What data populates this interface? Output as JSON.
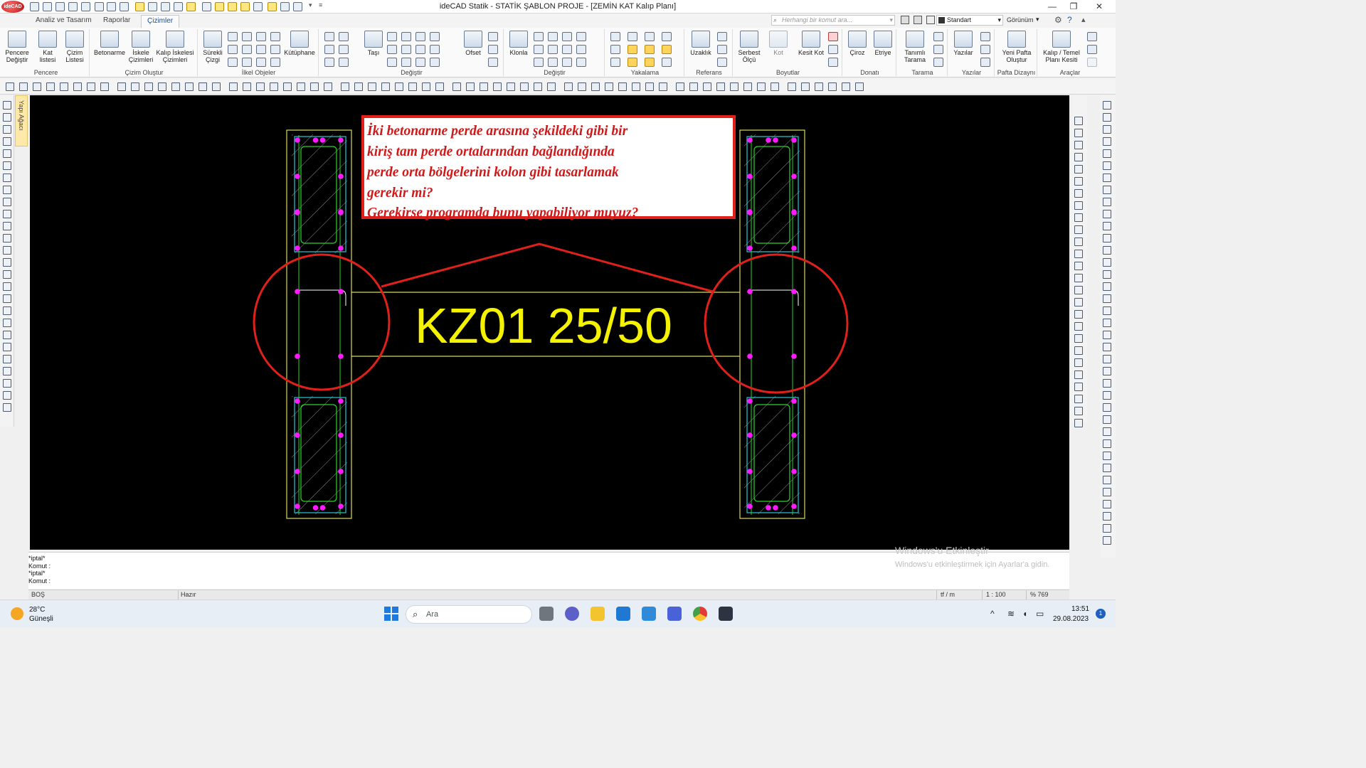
{
  "app": {
    "title": "ideCAD Statik - STATİK ŞABLON PROJE - [ZEMİN KAT Kalıp Planı]",
    "logo_text": "ideCAD"
  },
  "tabs": [
    {
      "label": "Analiz ve Tasarım",
      "active": false
    },
    {
      "label": "Raporlar",
      "active": false
    },
    {
      "label": "Çizimler",
      "active": true
    }
  ],
  "command_search": {
    "placeholder": "Herhangi bir komut ara..."
  },
  "style_select": {
    "value": "Standart"
  },
  "view_label": "Görünüm",
  "ribbon": {
    "groups": {
      "pencere": "Pencere",
      "cizim_olustur": "Çizim Oluştur",
      "ilkel_objeler": "İlkel Objeler",
      "degistir1": "Değiştir",
      "degistir2": "Değiştir",
      "yakalama": "Yakalama",
      "referans": "Referans",
      "boyutlar": "Boyutlar",
      "donati": "Donatı",
      "tarama": "Tarama",
      "yazilar": "Yazılar",
      "pafta": "Pafta Dizaynı",
      "araclar": "Araçlar"
    },
    "buttons": {
      "pencere_degistir": "Pencere Değiştir",
      "kat_listesi": "Kat listesi",
      "cizim_listesi": "Çizim Listesi",
      "betonarme": "Betonarme",
      "iskele_cizimleri": "İskele Çizimleri",
      "kalip_iskelesi": "Kalıp İskelesi Çizimleri",
      "surekli_cizgi": "Sürekli Çizgi",
      "kutuphane": "Kütüphane",
      "tasi": "Taşı",
      "ofset": "Ofset",
      "klonla": "Klonla",
      "uzaklik": "Uzaklık",
      "serbest_olcu": "Serbest Ölçü",
      "kot": "Kot",
      "kesit_kot": "Kesit Kot",
      "ciroz": "Çiroz",
      "etriye": "Etriye",
      "tanimli_tarama": "Tanımlı Tarama",
      "yazilar": "Yazılar",
      "yeni_pafta": "Yeni Pafta Oluştur",
      "kalip_temel": "Kalıp / Temel Planı Kesiti"
    }
  },
  "side_panel": {
    "label": "Yapı Ağacı"
  },
  "drawing": {
    "beam_label": "KZ01 25/50",
    "question_lines": [
      "İki betonarme perde arasına şekildeki gibi bir",
      "kiriş tam perde ortalarından bağlandığında",
      "perde orta bölgelerini kolon gibi tasarlamak",
      "gerekir mi?",
      "Gerekirse programda bunu yapabiliyor muyuz?"
    ],
    "colors": {
      "annotation_red": "#e0201a",
      "beam_yellow": "#f5f200",
      "rebar_magenta": "#ff1aff",
      "outline_yellow": "#d8d860",
      "hatch": "#9a9a9a",
      "stirrup_cyan": "#27c8d8",
      "bar_green": "#29d429"
    }
  },
  "command_lines": [
    "*iptal*",
    "Komut :",
    "*iptal*",
    "Komut :"
  ],
  "watermark": {
    "title": "Windows'u Etkinleştir",
    "subtitle": "Windows'u etkinleştirmek için Ayarlar'a gidin."
  },
  "status": {
    "left": "BOŞ",
    "state": "Hazır",
    "unit": "tf / m",
    "scale": "1 : 100",
    "zoom": "% 769"
  },
  "taskbar": {
    "temperature": "28°C",
    "condition": "Güneşli",
    "search_label": "Ara",
    "time": "13:51",
    "date": "29.08.2023",
    "notification_count": "1"
  }
}
